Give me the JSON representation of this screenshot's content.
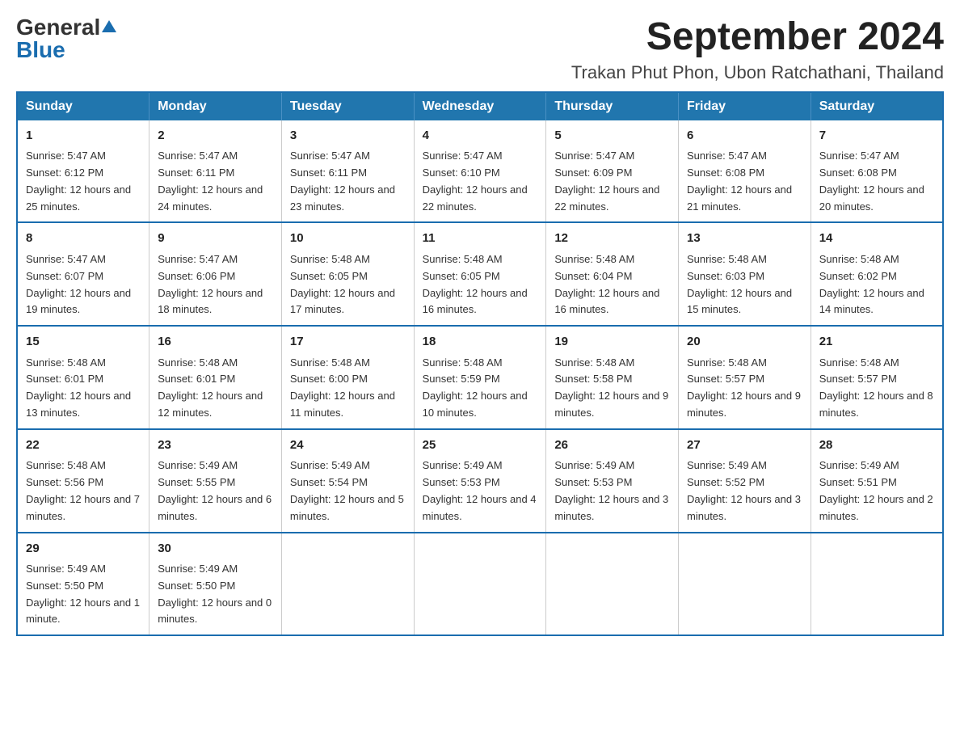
{
  "header": {
    "logo": {
      "general": "General",
      "blue": "Blue"
    },
    "title": "September 2024",
    "location": "Trakan Phut Phon, Ubon Ratchathani, Thailand"
  },
  "calendar": {
    "days_of_week": [
      "Sunday",
      "Monday",
      "Tuesday",
      "Wednesday",
      "Thursday",
      "Friday",
      "Saturday"
    ],
    "weeks": [
      [
        {
          "day": "1",
          "sunrise": "5:47 AM",
          "sunset": "6:12 PM",
          "daylight": "12 hours and 25 minutes."
        },
        {
          "day": "2",
          "sunrise": "5:47 AM",
          "sunset": "6:11 PM",
          "daylight": "12 hours and 24 minutes."
        },
        {
          "day": "3",
          "sunrise": "5:47 AM",
          "sunset": "6:11 PM",
          "daylight": "12 hours and 23 minutes."
        },
        {
          "day": "4",
          "sunrise": "5:47 AM",
          "sunset": "6:10 PM",
          "daylight": "12 hours and 22 minutes."
        },
        {
          "day": "5",
          "sunrise": "5:47 AM",
          "sunset": "6:09 PM",
          "daylight": "12 hours and 22 minutes."
        },
        {
          "day": "6",
          "sunrise": "5:47 AM",
          "sunset": "6:08 PM",
          "daylight": "12 hours and 21 minutes."
        },
        {
          "day": "7",
          "sunrise": "5:47 AM",
          "sunset": "6:08 PM",
          "daylight": "12 hours and 20 minutes."
        }
      ],
      [
        {
          "day": "8",
          "sunrise": "5:47 AM",
          "sunset": "6:07 PM",
          "daylight": "12 hours and 19 minutes."
        },
        {
          "day": "9",
          "sunrise": "5:47 AM",
          "sunset": "6:06 PM",
          "daylight": "12 hours and 18 minutes."
        },
        {
          "day": "10",
          "sunrise": "5:48 AM",
          "sunset": "6:05 PM",
          "daylight": "12 hours and 17 minutes."
        },
        {
          "day": "11",
          "sunrise": "5:48 AM",
          "sunset": "6:05 PM",
          "daylight": "12 hours and 16 minutes."
        },
        {
          "day": "12",
          "sunrise": "5:48 AM",
          "sunset": "6:04 PM",
          "daylight": "12 hours and 16 minutes."
        },
        {
          "day": "13",
          "sunrise": "5:48 AM",
          "sunset": "6:03 PM",
          "daylight": "12 hours and 15 minutes."
        },
        {
          "day": "14",
          "sunrise": "5:48 AM",
          "sunset": "6:02 PM",
          "daylight": "12 hours and 14 minutes."
        }
      ],
      [
        {
          "day": "15",
          "sunrise": "5:48 AM",
          "sunset": "6:01 PM",
          "daylight": "12 hours and 13 minutes."
        },
        {
          "day": "16",
          "sunrise": "5:48 AM",
          "sunset": "6:01 PM",
          "daylight": "12 hours and 12 minutes."
        },
        {
          "day": "17",
          "sunrise": "5:48 AM",
          "sunset": "6:00 PM",
          "daylight": "12 hours and 11 minutes."
        },
        {
          "day": "18",
          "sunrise": "5:48 AM",
          "sunset": "5:59 PM",
          "daylight": "12 hours and 10 minutes."
        },
        {
          "day": "19",
          "sunrise": "5:48 AM",
          "sunset": "5:58 PM",
          "daylight": "12 hours and 9 minutes."
        },
        {
          "day": "20",
          "sunrise": "5:48 AM",
          "sunset": "5:57 PM",
          "daylight": "12 hours and 9 minutes."
        },
        {
          "day": "21",
          "sunrise": "5:48 AM",
          "sunset": "5:57 PM",
          "daylight": "12 hours and 8 minutes."
        }
      ],
      [
        {
          "day": "22",
          "sunrise": "5:48 AM",
          "sunset": "5:56 PM",
          "daylight": "12 hours and 7 minutes."
        },
        {
          "day": "23",
          "sunrise": "5:49 AM",
          "sunset": "5:55 PM",
          "daylight": "12 hours and 6 minutes."
        },
        {
          "day": "24",
          "sunrise": "5:49 AM",
          "sunset": "5:54 PM",
          "daylight": "12 hours and 5 minutes."
        },
        {
          "day": "25",
          "sunrise": "5:49 AM",
          "sunset": "5:53 PM",
          "daylight": "12 hours and 4 minutes."
        },
        {
          "day": "26",
          "sunrise": "5:49 AM",
          "sunset": "5:53 PM",
          "daylight": "12 hours and 3 minutes."
        },
        {
          "day": "27",
          "sunrise": "5:49 AM",
          "sunset": "5:52 PM",
          "daylight": "12 hours and 3 minutes."
        },
        {
          "day": "28",
          "sunrise": "5:49 AM",
          "sunset": "5:51 PM",
          "daylight": "12 hours and 2 minutes."
        }
      ],
      [
        {
          "day": "29",
          "sunrise": "5:49 AM",
          "sunset": "5:50 PM",
          "daylight": "12 hours and 1 minute."
        },
        {
          "day": "30",
          "sunrise": "5:49 AM",
          "sunset": "5:50 PM",
          "daylight": "12 hours and 0 minutes."
        },
        null,
        null,
        null,
        null,
        null
      ]
    ]
  }
}
